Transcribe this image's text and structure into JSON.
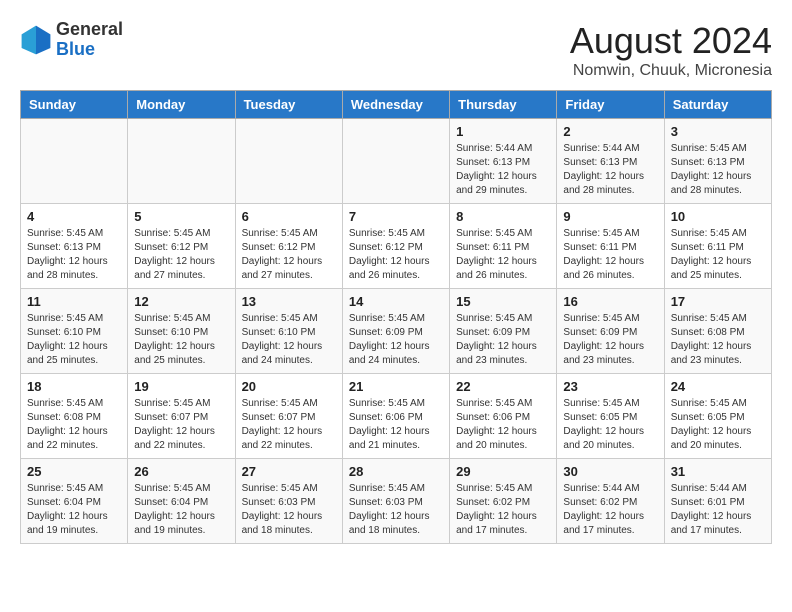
{
  "header": {
    "logo_line1": "General",
    "logo_line2": "Blue",
    "month_year": "August 2024",
    "location": "Nomwin, Chuuk, Micronesia"
  },
  "days_of_week": [
    "Sunday",
    "Monday",
    "Tuesday",
    "Wednesday",
    "Thursday",
    "Friday",
    "Saturday"
  ],
  "weeks": [
    [
      {
        "day": "",
        "info": ""
      },
      {
        "day": "",
        "info": ""
      },
      {
        "day": "",
        "info": ""
      },
      {
        "day": "",
        "info": ""
      },
      {
        "day": "1",
        "info": "Sunrise: 5:44 AM\nSunset: 6:13 PM\nDaylight: 12 hours\nand 29 minutes."
      },
      {
        "day": "2",
        "info": "Sunrise: 5:44 AM\nSunset: 6:13 PM\nDaylight: 12 hours\nand 28 minutes."
      },
      {
        "day": "3",
        "info": "Sunrise: 5:45 AM\nSunset: 6:13 PM\nDaylight: 12 hours\nand 28 minutes."
      }
    ],
    [
      {
        "day": "4",
        "info": "Sunrise: 5:45 AM\nSunset: 6:13 PM\nDaylight: 12 hours\nand 28 minutes."
      },
      {
        "day": "5",
        "info": "Sunrise: 5:45 AM\nSunset: 6:12 PM\nDaylight: 12 hours\nand 27 minutes."
      },
      {
        "day": "6",
        "info": "Sunrise: 5:45 AM\nSunset: 6:12 PM\nDaylight: 12 hours\nand 27 minutes."
      },
      {
        "day": "7",
        "info": "Sunrise: 5:45 AM\nSunset: 6:12 PM\nDaylight: 12 hours\nand 26 minutes."
      },
      {
        "day": "8",
        "info": "Sunrise: 5:45 AM\nSunset: 6:11 PM\nDaylight: 12 hours\nand 26 minutes."
      },
      {
        "day": "9",
        "info": "Sunrise: 5:45 AM\nSunset: 6:11 PM\nDaylight: 12 hours\nand 26 minutes."
      },
      {
        "day": "10",
        "info": "Sunrise: 5:45 AM\nSunset: 6:11 PM\nDaylight: 12 hours\nand 25 minutes."
      }
    ],
    [
      {
        "day": "11",
        "info": "Sunrise: 5:45 AM\nSunset: 6:10 PM\nDaylight: 12 hours\nand 25 minutes."
      },
      {
        "day": "12",
        "info": "Sunrise: 5:45 AM\nSunset: 6:10 PM\nDaylight: 12 hours\nand 25 minutes."
      },
      {
        "day": "13",
        "info": "Sunrise: 5:45 AM\nSunset: 6:10 PM\nDaylight: 12 hours\nand 24 minutes."
      },
      {
        "day": "14",
        "info": "Sunrise: 5:45 AM\nSunset: 6:09 PM\nDaylight: 12 hours\nand 24 minutes."
      },
      {
        "day": "15",
        "info": "Sunrise: 5:45 AM\nSunset: 6:09 PM\nDaylight: 12 hours\nand 23 minutes."
      },
      {
        "day": "16",
        "info": "Sunrise: 5:45 AM\nSunset: 6:09 PM\nDaylight: 12 hours\nand 23 minutes."
      },
      {
        "day": "17",
        "info": "Sunrise: 5:45 AM\nSunset: 6:08 PM\nDaylight: 12 hours\nand 23 minutes."
      }
    ],
    [
      {
        "day": "18",
        "info": "Sunrise: 5:45 AM\nSunset: 6:08 PM\nDaylight: 12 hours\nand 22 minutes."
      },
      {
        "day": "19",
        "info": "Sunrise: 5:45 AM\nSunset: 6:07 PM\nDaylight: 12 hours\nand 22 minutes."
      },
      {
        "day": "20",
        "info": "Sunrise: 5:45 AM\nSunset: 6:07 PM\nDaylight: 12 hours\nand 22 minutes."
      },
      {
        "day": "21",
        "info": "Sunrise: 5:45 AM\nSunset: 6:06 PM\nDaylight: 12 hours\nand 21 minutes."
      },
      {
        "day": "22",
        "info": "Sunrise: 5:45 AM\nSunset: 6:06 PM\nDaylight: 12 hours\nand 20 minutes."
      },
      {
        "day": "23",
        "info": "Sunrise: 5:45 AM\nSunset: 6:05 PM\nDaylight: 12 hours\nand 20 minutes."
      },
      {
        "day": "24",
        "info": "Sunrise: 5:45 AM\nSunset: 6:05 PM\nDaylight: 12 hours\nand 20 minutes."
      }
    ],
    [
      {
        "day": "25",
        "info": "Sunrise: 5:45 AM\nSunset: 6:04 PM\nDaylight: 12 hours\nand 19 minutes."
      },
      {
        "day": "26",
        "info": "Sunrise: 5:45 AM\nSunset: 6:04 PM\nDaylight: 12 hours\nand 19 minutes."
      },
      {
        "day": "27",
        "info": "Sunrise: 5:45 AM\nSunset: 6:03 PM\nDaylight: 12 hours\nand 18 minutes."
      },
      {
        "day": "28",
        "info": "Sunrise: 5:45 AM\nSunset: 6:03 PM\nDaylight: 12 hours\nand 18 minutes."
      },
      {
        "day": "29",
        "info": "Sunrise: 5:45 AM\nSunset: 6:02 PM\nDaylight: 12 hours\nand 17 minutes."
      },
      {
        "day": "30",
        "info": "Sunrise: 5:44 AM\nSunset: 6:02 PM\nDaylight: 12 hours\nand 17 minutes."
      },
      {
        "day": "31",
        "info": "Sunrise: 5:44 AM\nSunset: 6:01 PM\nDaylight: 12 hours\nand 17 minutes."
      }
    ]
  ]
}
